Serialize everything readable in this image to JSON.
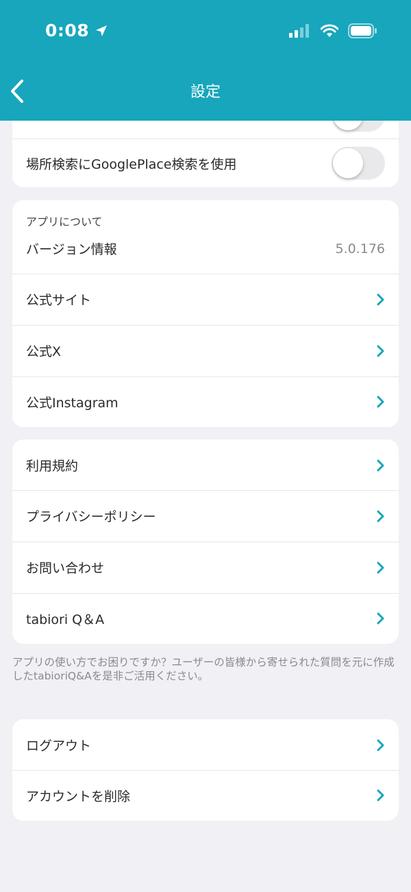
{
  "status_bar": {
    "time": "0:08"
  },
  "nav": {
    "title": "設定"
  },
  "settings_partial": {
    "hidden_toggle_label": "",
    "google_place_label": "場所検索にGooglePlace検索を使用"
  },
  "about": {
    "header": "アプリについて",
    "version_label": "バージョン情報",
    "version_value": "5.0.176",
    "official_site": "公式サイト",
    "official_x": "公式X",
    "official_instagram": "公式Instagram"
  },
  "support": {
    "terms": "利用規約",
    "privacy": "プライバシーポリシー",
    "contact": "お問い合わせ",
    "qa": "tabiori Q＆A"
  },
  "footnote": "アプリの使い方でお困りですか？ユーザーの皆様から寄せられた質問を元に作成したtabioriQ&Aを是非ご活用ください。",
  "account": {
    "logout": "ログアウト",
    "delete": "アカウントを削除"
  },
  "colors": {
    "accent": "#17a6bc",
    "background": "#f0f0f5",
    "card": "#ffffff",
    "secondary_text": "#8a8a8e"
  }
}
